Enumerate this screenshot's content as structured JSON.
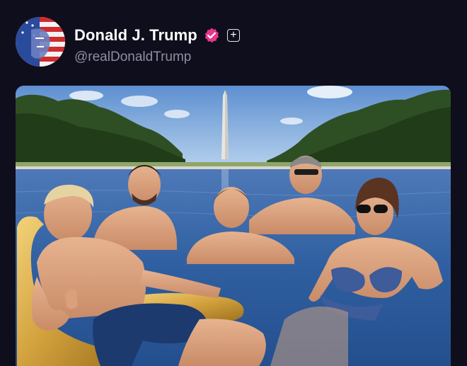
{
  "post": {
    "author": {
      "display_name": "Donald J. Trump",
      "handle": "@realDonaldTrump",
      "verified": true,
      "verified_color": "#e8368c",
      "avatar_icon": "flag-portrait-avatar"
    },
    "follow_button": {
      "icon": "plus-icon",
      "symbol": "+"
    },
    "media": {
      "type": "photo"
    }
  },
  "colors": {
    "background": "#0f0e1c",
    "name_text": "#ffffff",
    "handle_text": "#8f8ea3",
    "verified_badge": "#e8368c"
  }
}
